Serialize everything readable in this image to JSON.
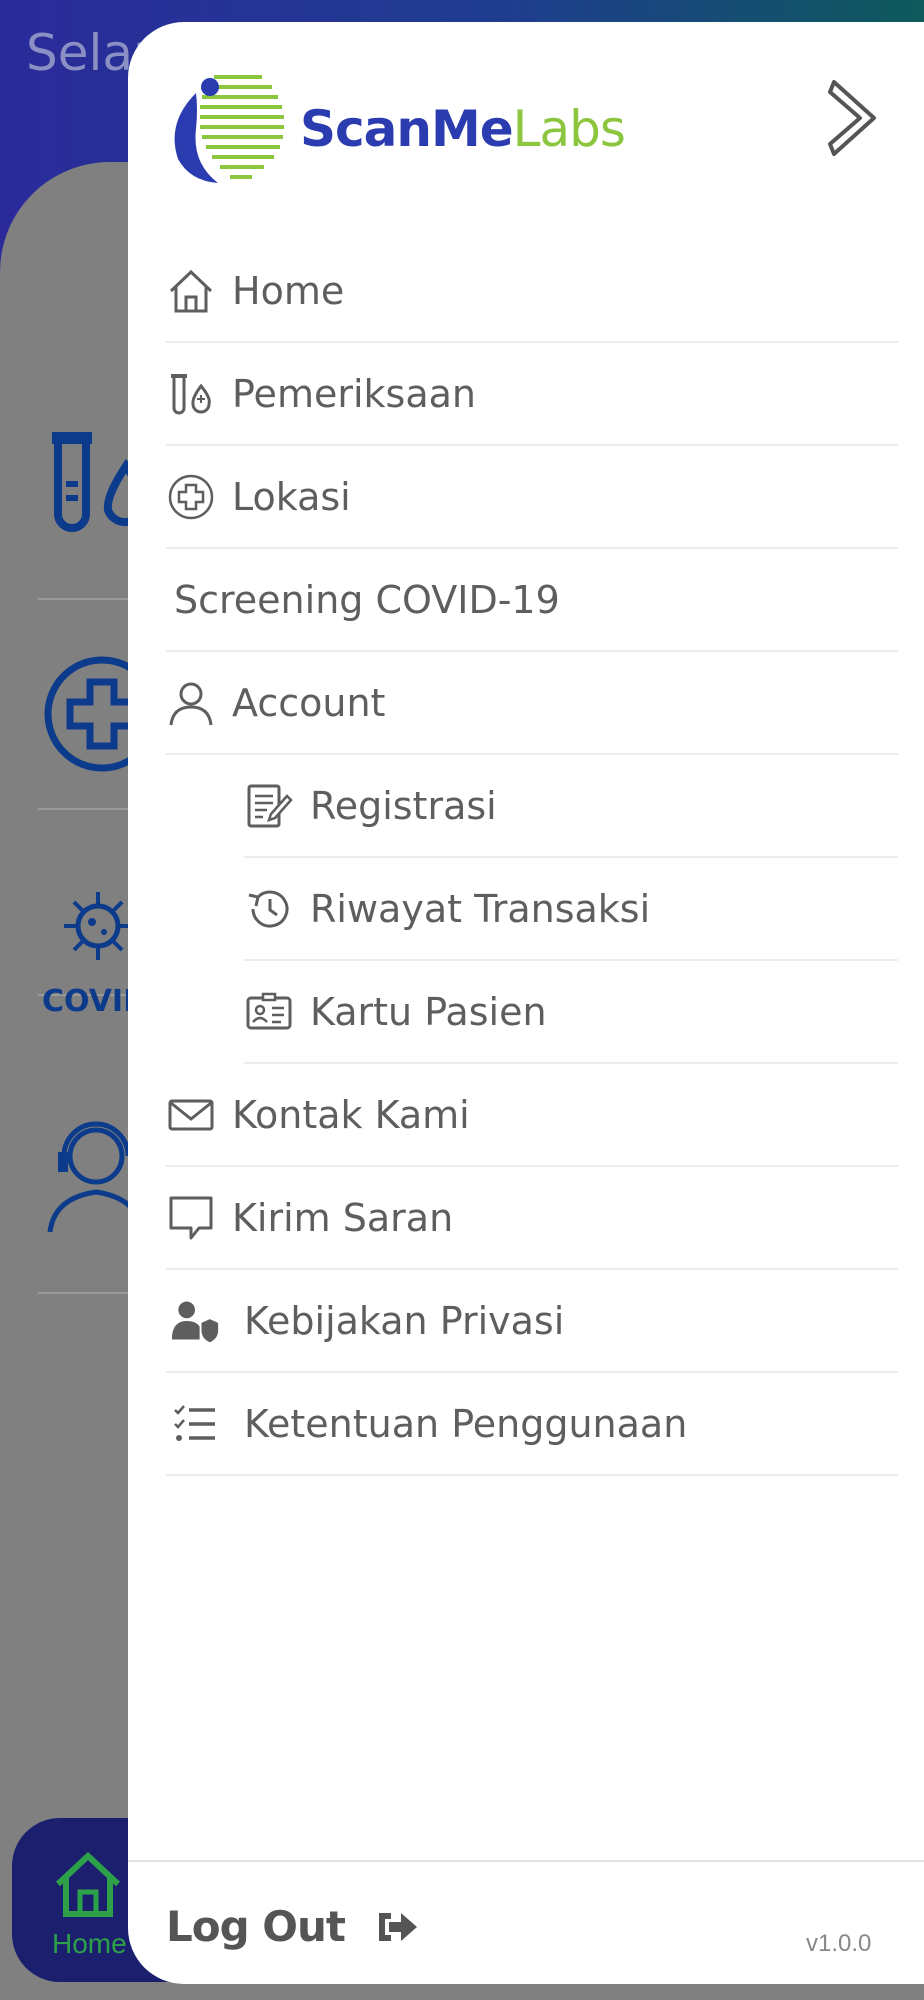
{
  "background": {
    "greeting_partial": "Selan",
    "covid_label": "COVID",
    "bottom_nav": {
      "home_label": "Home"
    }
  },
  "drawer": {
    "logo": {
      "part1": "ScanMe",
      "part2": "Labs"
    },
    "close_icon": "chevron-right-icon",
    "menu": [
      {
        "label": "Home",
        "icon": "home-icon"
      },
      {
        "label": "Pemeriksaan",
        "icon": "test-tube-icon"
      },
      {
        "label": "Lokasi",
        "icon": "medical-cross-icon"
      },
      {
        "label": "Screening COVID-19",
        "icon": ""
      },
      {
        "label": "Account",
        "icon": "user-icon"
      },
      {
        "label": "Registrasi",
        "icon": "registration-form-icon"
      },
      {
        "label": "Riwayat Transaksi",
        "icon": "history-icon"
      },
      {
        "label": "Kartu Pasien",
        "icon": "id-card-icon"
      },
      {
        "label": "Kontak Kami",
        "icon": "mail-icon"
      },
      {
        "label": "Kirim Saran",
        "icon": "chat-bubble-icon"
      },
      {
        "label": "Kebijakan Privasi",
        "icon": "user-shield-icon"
      },
      {
        "label": "Ketentuan Penggunaan",
        "icon": "checklist-icon"
      }
    ],
    "logout_label": "Log Out",
    "version": "v1.0.0"
  },
  "colors": {
    "brand_blue": "#2a3cb0",
    "brand_green": "#8cc63f",
    "menu_text": "#5e5e5e",
    "overlay_gray": "#808080"
  }
}
